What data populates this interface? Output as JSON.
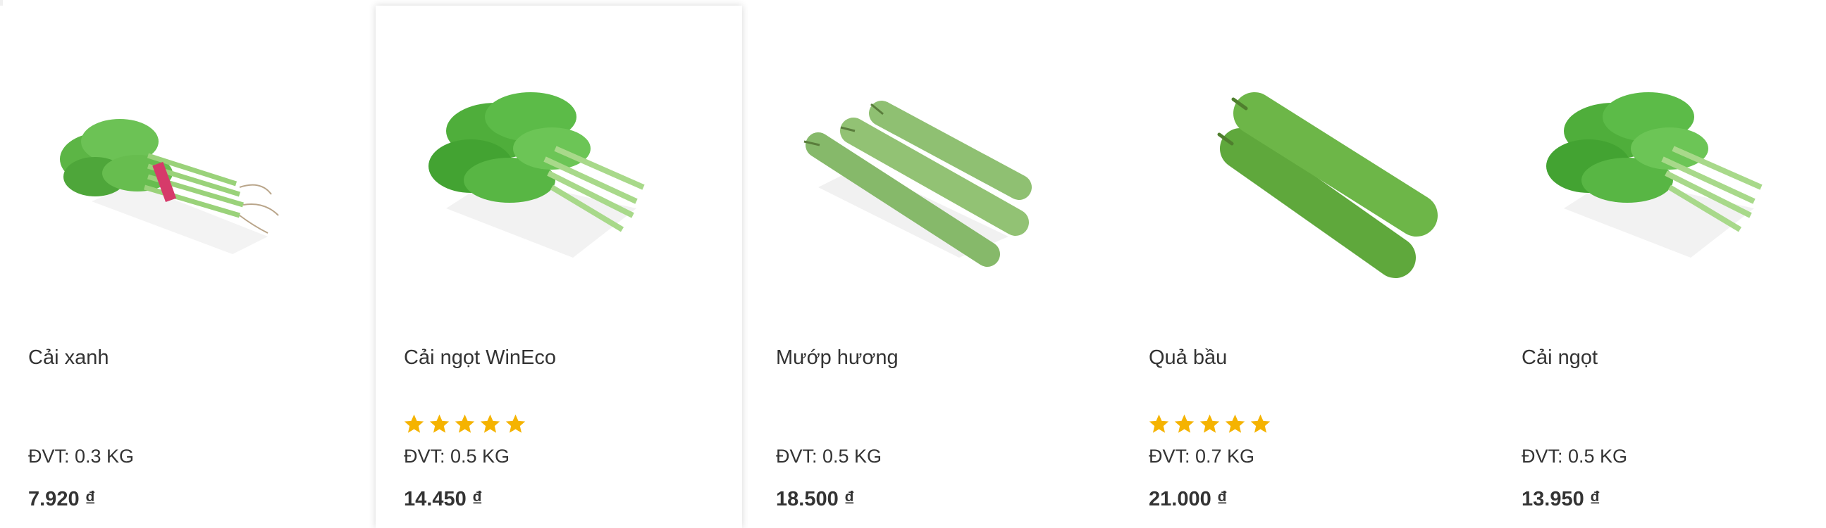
{
  "products": [
    {
      "name": "Cải xanh",
      "unit": "ĐVT: 0.3 KG",
      "price": "7.920 ₫",
      "image": "mustard-greens-icon",
      "rating": 0
    },
    {
      "name": "Cải ngọt WinEco",
      "unit": "ĐVT: 0.5 KG",
      "price": "14.450 ₫",
      "image": "choy-sum-icon",
      "rating": 5
    },
    {
      "name": "Mướp hương",
      "unit": "ĐVT: 0.5 KG",
      "price": "18.500 ₫",
      "image": "luffa-icon",
      "rating": 0
    },
    {
      "name": "Quả bầu",
      "unit": "ĐVT: 0.7 KG",
      "price": "21.000 ₫",
      "image": "bottle-gourd-icon",
      "rating": 5
    },
    {
      "name": "Cải ngọt",
      "unit": "ĐVT: 0.5 KG",
      "price": "13.950 ₫",
      "image": "choy-sum-icon",
      "rating": 0
    }
  ],
  "colors": {
    "star": "#f5b301",
    "text": "#333333",
    "leaf": "#4caf3c",
    "gourd": "#7cbf5a"
  }
}
